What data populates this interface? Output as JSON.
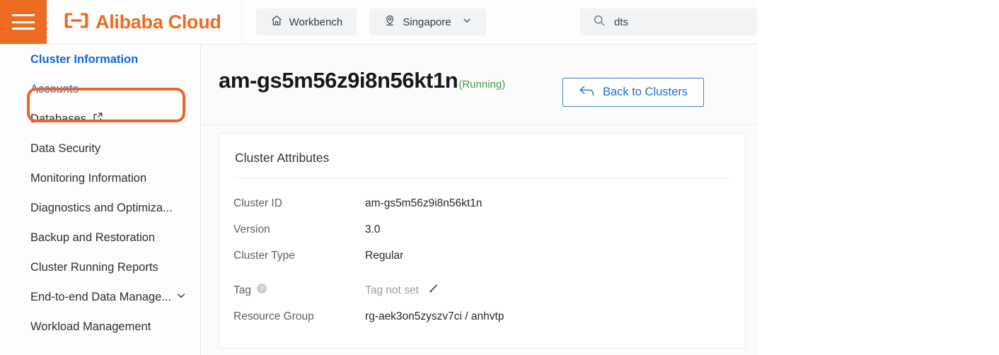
{
  "header": {
    "menu_icon": "hamburger-icon",
    "brand": "Alibaba Cloud",
    "brand_mark": "alibaba-cloud-logo",
    "workbench": {
      "label": "Workbench",
      "icon": "home-icon"
    },
    "region": {
      "label": "Singapore",
      "icon": "location-pin-icon",
      "caret": "chevron-down-icon"
    },
    "search": {
      "value": "dts",
      "icon": "search-icon"
    }
  },
  "sidebar": {
    "items": [
      {
        "label": "Cluster Information",
        "state": "active"
      },
      {
        "label": "Accounts",
        "state": "link"
      },
      {
        "label": "Databases",
        "state": "normal",
        "icon": "external-link-icon"
      },
      {
        "label": "Data Security",
        "state": "normal"
      },
      {
        "label": "Monitoring Information",
        "state": "normal"
      },
      {
        "label": "Diagnostics and Optimiza...",
        "state": "normal"
      },
      {
        "label": "Backup and Restoration",
        "state": "normal"
      },
      {
        "label": "Cluster Running Reports",
        "state": "normal"
      },
      {
        "label": "End-to-end Data Manage...",
        "state": "normal",
        "caret": "chevron-down-icon"
      },
      {
        "label": "Workload Management",
        "state": "normal"
      }
    ]
  },
  "main": {
    "title": "am-gs5m56z9i8n56kt1n",
    "status": "(Running)",
    "status_color": "#4a9c4a",
    "back_button": {
      "label": "Back to Clusters",
      "icon": "back-arrow-icon"
    },
    "card": {
      "title": "Cluster Attributes",
      "rows": [
        {
          "label": "Cluster ID",
          "value": "am-gs5m56z9i8n56kt1n"
        },
        {
          "label": "Version",
          "value": "3.0"
        },
        {
          "label": "Cluster Type",
          "value": "Regular"
        },
        {
          "label": "Tag",
          "value": "Tag not set",
          "label_icon": "help-circle-icon",
          "value_icon": "pencil-edit-icon",
          "muted": true
        },
        {
          "label": "Resource Group",
          "value": "rg-aek3on5zyszv7ci / anhvtp"
        }
      ]
    }
  },
  "colors": {
    "brand_orange": "#ee6b22",
    "accent_blue": "#1366d6",
    "annotation_orange": "#ec6430",
    "running_green": "#4a9c4a"
  }
}
